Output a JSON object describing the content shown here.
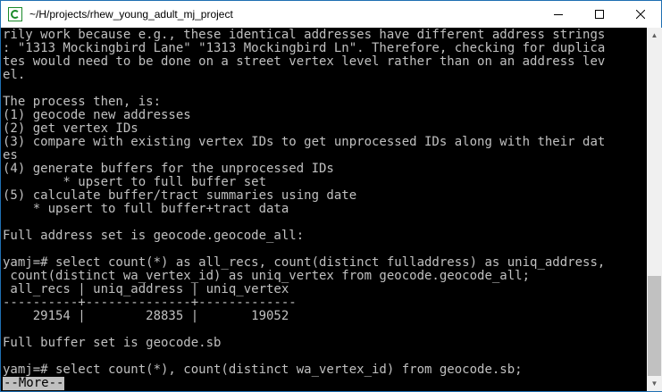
{
  "window": {
    "title": "~/H/projects/rhew_young_adult_mj_project"
  },
  "controls": {
    "minimize": "—",
    "maximize": "☐",
    "close": "✕"
  },
  "terminal": {
    "lines": [
      "rily work because e.g., these identical addresses have different address strings",
      ": \"1313 Mockingbird Lane\" \"1313 Mockingbird Ln\". Therefore, checking for duplica",
      "tes would need to be done on a street vertex level rather than on an address lev",
      "el.",
      "",
      "The process then, is:",
      "(1) geocode new addresses",
      "(2) get vertex IDs",
      "(3) compare with existing vertex IDs to get unprocessed IDs along with their dat",
      "es",
      "(4) generate buffers for the unprocessed IDs",
      "        * upsert to full buffer set",
      "(5) calculate buffer/tract summaries using date",
      "    * upsert to full buffer+tract data",
      "",
      "Full address set is geocode.geocode_all:",
      "",
      "yamj=# select count(*) as all_recs, count(distinct fulladdress) as uniq_address,",
      " count(distinct wa_vertex_id) as uniq_vertex from geocode.geocode_all;",
      " all_recs | uniq_address | uniq_vertex",
      "----------+--------------+-------------",
      "    29154 |        28835 |       19052",
      "",
      "Full buffer set is geocode.sb",
      "",
      "yamj=# select count(*), count(distinct wa_vertex_id) from geocode.sb;"
    ],
    "more_prompt": "--More--"
  },
  "scrollbar": {
    "up_arrow": "▲",
    "down_arrow": "▼"
  }
}
